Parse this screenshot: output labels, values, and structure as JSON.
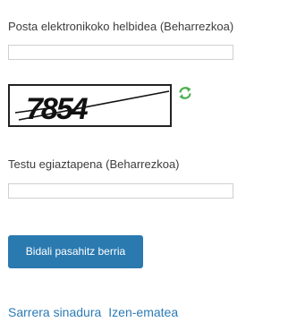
{
  "form": {
    "email_label": "Posta elektronikoko helbidea (Beharrezkoa)",
    "email_value": "",
    "captcha_image_text": "7854",
    "captcha_label": "Testu egiaztapena (Beharrezkoa)",
    "captcha_value": "",
    "submit_label": "Bidali pasahitz berria"
  },
  "icons": {
    "refresh": "refresh-icon",
    "refresh_color": "#4caf50"
  },
  "links": {
    "signin": "Sarrera sinadura",
    "register": "Izen-ematea"
  },
  "colors": {
    "button": "#2a7ab0",
    "link": "#2b7bb5"
  }
}
